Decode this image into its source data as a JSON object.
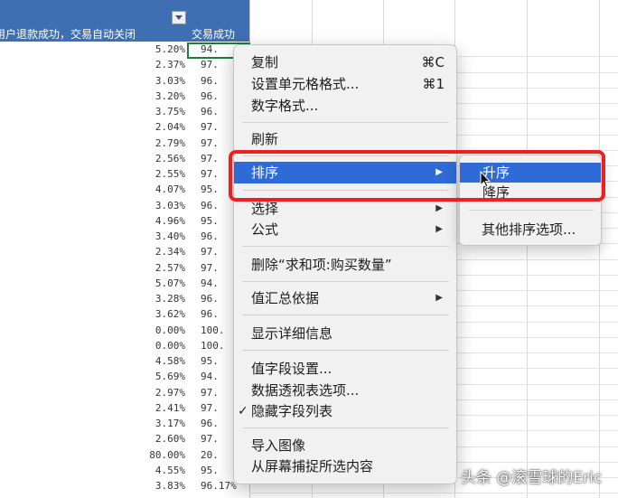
{
  "spreadsheet": {
    "header": {
      "col_a": "用户退款成功，交易自动关闭",
      "col_b": "交易成功"
    },
    "rows": [
      {
        "a": "5.20%",
        "b": "94."
      },
      {
        "a": "2.37%",
        "b": "97."
      },
      {
        "a": "3.03%",
        "b": "96."
      },
      {
        "a": "3.20%",
        "b": "96."
      },
      {
        "a": "3.75%",
        "b": "96."
      },
      {
        "a": "2.04%",
        "b": "97."
      },
      {
        "a": "2.79%",
        "b": "97."
      },
      {
        "a": "2.56%",
        "b": "97."
      },
      {
        "a": "2.55%",
        "b": "97."
      },
      {
        "a": "4.07%",
        "b": "95."
      },
      {
        "a": "3.03%",
        "b": "96."
      },
      {
        "a": "4.96%",
        "b": "95."
      },
      {
        "a": "3.40%",
        "b": "96."
      },
      {
        "a": "2.34%",
        "b": "97."
      },
      {
        "a": "2.57%",
        "b": "97."
      },
      {
        "a": "5.07%",
        "b": "94."
      },
      {
        "a": "3.28%",
        "b": "96."
      },
      {
        "a": "3.62%",
        "b": "96."
      },
      {
        "a": "0.00%",
        "b": "100."
      },
      {
        "a": "0.00%",
        "b": "100."
      },
      {
        "a": "4.58%",
        "b": "95."
      },
      {
        "a": "5.69%",
        "b": "94."
      },
      {
        "a": "2.97%",
        "b": "97."
      },
      {
        "a": "2.41%",
        "b": "97."
      },
      {
        "a": "3.17%",
        "b": "96."
      },
      {
        "a": "2.60%",
        "b": "97."
      },
      {
        "a": "80.00%",
        "b": "20."
      },
      {
        "a": "4.55%",
        "b": "95."
      },
      {
        "a": "3.83%",
        "b": "96.17%"
      }
    ]
  },
  "context_menu": {
    "copy": {
      "label": "复制",
      "shortcut": "⌘C"
    },
    "format_cells": {
      "label": "设置单元格格式...",
      "shortcut": "⌘1"
    },
    "number_format": {
      "label": "数字格式..."
    },
    "refresh": {
      "label": "刷新"
    },
    "sort": {
      "label": "排序"
    },
    "select": {
      "label": "选择"
    },
    "formula": {
      "label": "公式"
    },
    "remove_field": {
      "label": "删除“求和项:购买数量”"
    },
    "summarize_by": {
      "label": "值汇总依据"
    },
    "show_details": {
      "label": "显示详细信息"
    },
    "field_settings": {
      "label": "值字段设置..."
    },
    "pivot_options": {
      "label": "数据透视表选项..."
    },
    "hide_field_list": {
      "label": "隐藏字段列表",
      "checked": true
    },
    "import_image": {
      "label": "导入图像"
    },
    "capture_screen": {
      "label": "从屏幕捕捉所选内容"
    }
  },
  "submenu": {
    "ascending": "升序",
    "descending": "降序",
    "more_options": "其他排序选项..."
  },
  "watermark": "头条 @滚雪球的Eric",
  "colors": {
    "header_blue": "#3e6fb3",
    "highlight_blue": "#2f6bd6",
    "annotation_red": "#ef1f1f",
    "active_cell_green": "#1e7b43"
  }
}
